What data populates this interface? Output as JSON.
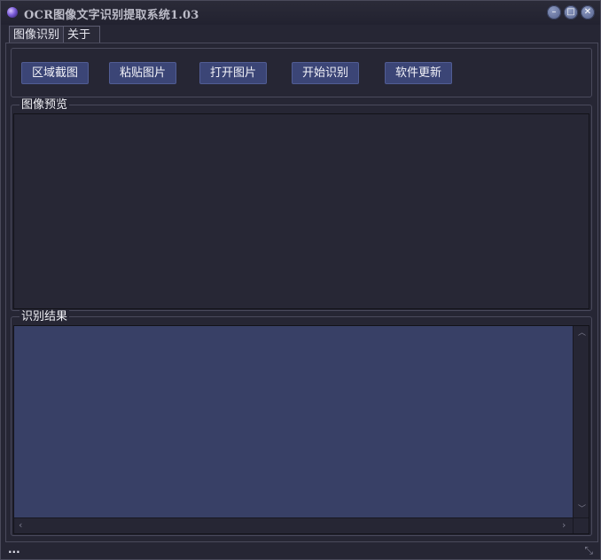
{
  "window": {
    "title": "OCR图像文字识别提取系统1.03"
  },
  "title_buttons": {
    "minimize": "–",
    "maximize": "□",
    "close": "✕"
  },
  "tabs": [
    {
      "label": "图像识别",
      "active": true
    },
    {
      "label": "关于",
      "active": false
    }
  ],
  "toolbar": {
    "buttons": [
      {
        "label": "区域截图"
      },
      {
        "label": "粘贴图片"
      },
      {
        "label": "打开图片"
      },
      {
        "label": "开始识别"
      },
      {
        "label": "软件更新"
      }
    ]
  },
  "preview": {
    "label": "图像预览"
  },
  "result": {
    "label": "识别结果",
    "text": ""
  },
  "status": {
    "text": "..."
  },
  "colors": {
    "button_bg": "#3b4576",
    "result_bg": "#384066",
    "window_bg": "#262634"
  }
}
